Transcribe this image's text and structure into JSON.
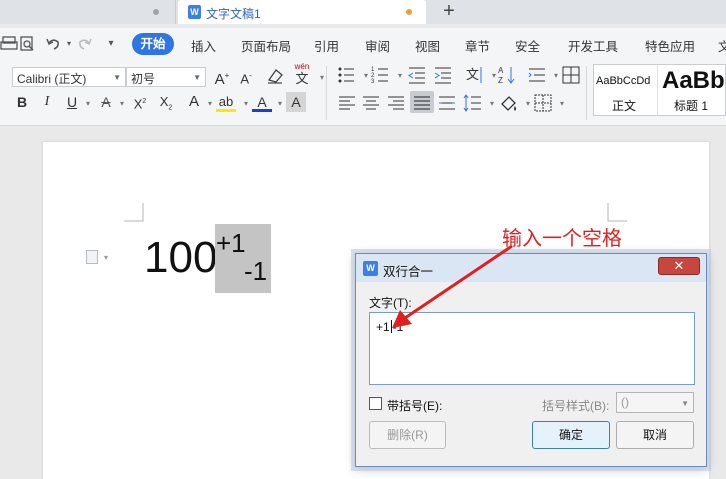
{
  "tabs": {
    "doc_tab_label": "文字文稿1",
    "new_tab_symbol": "+"
  },
  "quick_access": {
    "icons": [
      "print-icon",
      "print-preview-icon",
      "undo-icon",
      "redo-icon",
      "more-icon"
    ]
  },
  "menu": {
    "active": "开始",
    "items": [
      "插入",
      "页面布局",
      "引用",
      "审阅",
      "视图",
      "章节",
      "安全",
      "开发工具",
      "特色应用",
      "文"
    ]
  },
  "ribbon": {
    "font_name": "Calibri (正文)",
    "font_size": "初号",
    "style_preview_1": "AaBbCcDd",
    "style_name_1": "正文",
    "style_preview_2": "AaBb",
    "style_name_2": "标题 1",
    "phonetic_top": "wén",
    "phonetic_char": "文",
    "color_font_underline": "#1a3fcc",
    "color_highlight": "#ffe600"
  },
  "document": {
    "base_text": "100",
    "stack_top": "+1",
    "stack_bottom": "-1"
  },
  "annotation": {
    "text": "输入一个空格",
    "color": "#e02020"
  },
  "dialog": {
    "title": "双行合一",
    "close_symbol": "✕",
    "text_label": "文字(T):",
    "text_before_caret": "+1",
    "text_after_caret": "-1",
    "bracket_checkbox_label": "带括号(E):",
    "bracket_checked": false,
    "bracket_style_label": "括号样式(B):",
    "bracket_style_value": "()",
    "delete_button": "删除(R)",
    "ok_button": "确定",
    "cancel_button": "取消"
  }
}
